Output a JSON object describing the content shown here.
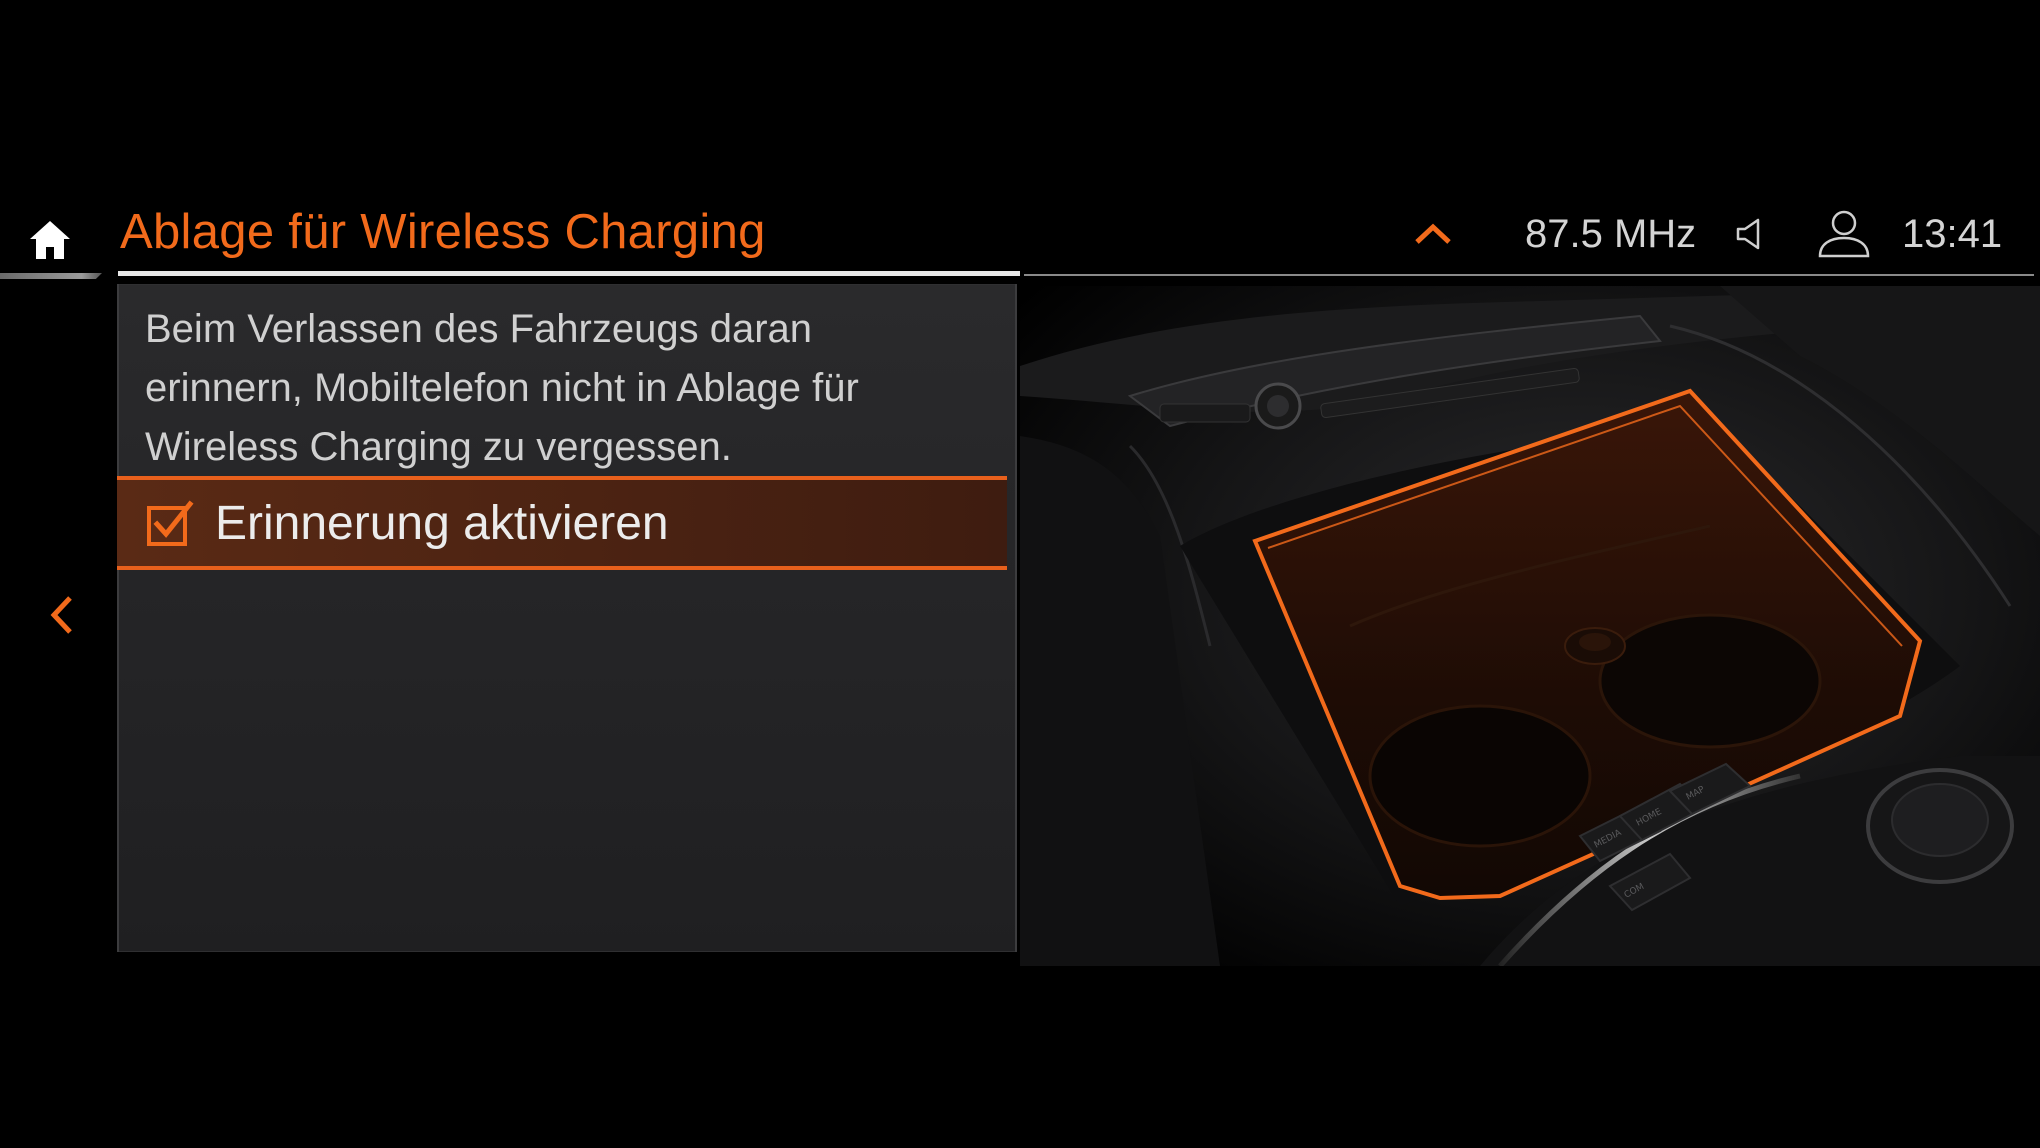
{
  "header": {
    "title": "Ablage für Wireless Charging",
    "radio_frequency": "87.5 MHz",
    "time": "13:41",
    "icons": {
      "home": "home-icon",
      "expand": "chevron-up-icon",
      "volume": "speaker-icon",
      "profile": "user-profile-icon"
    }
  },
  "navigation": {
    "back_icon": "chevron-left-icon"
  },
  "content": {
    "description_lines": [
      "Beim Verlassen des Fahrzeugs daran",
      "erinnern, Mobiltelefon nicht in Ablage für",
      "Wireless Charging zu vergessen."
    ],
    "option": {
      "label": "Erinnerung aktivieren",
      "checked": true
    }
  },
  "illustration": {
    "subject": "center-console-wireless-charging-tray",
    "button_labels": [
      "MEDIA",
      "HOME",
      "MAP",
      "COM"
    ]
  },
  "colors": {
    "accent": "#f26a1b",
    "background": "#000000",
    "panel": "#262628",
    "selected_row": "#4a2212",
    "text_primary": "#d9d9d9"
  }
}
